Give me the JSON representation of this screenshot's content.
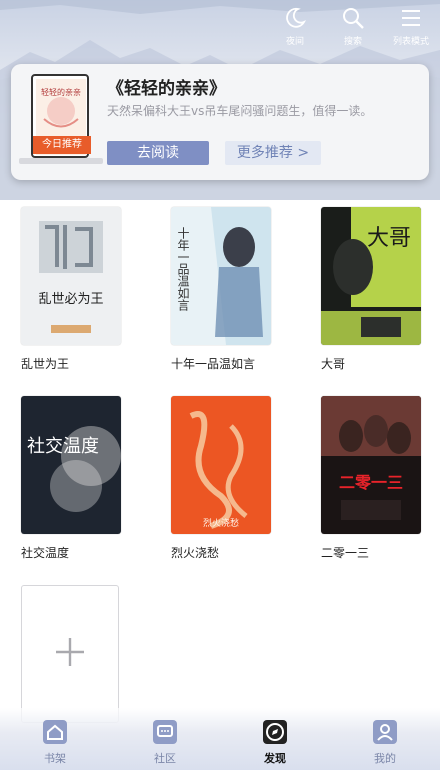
{
  "top_actions": [
    {
      "label": "夜间",
      "icon": "moon-icon"
    },
    {
      "label": "搜索",
      "icon": "search-icon"
    },
    {
      "label": "列表模式",
      "icon": "list-mode-icon"
    }
  ],
  "recommendation": {
    "title": "《轻轻的亲亲》",
    "description": "天然呆偏科大王vs吊车尾闷骚问题生，值得一读。",
    "badge": "今日推荐",
    "read_button": "去阅读",
    "more_button": "更多推荐 >",
    "cover_text": "轻轻的亲亲"
  },
  "books": [
    {
      "name": "乱世为王",
      "cover_text": "乱世必为王"
    },
    {
      "name": "十年一品温如言",
      "cover_text": "十年一品温如言"
    },
    {
      "name": "大哥",
      "cover_text": "大哥"
    },
    {
      "name": "社交温度",
      "cover_text": "社交温度"
    },
    {
      "name": "烈火浇愁",
      "cover_text": "烈火浇愁"
    },
    {
      "name": "二零一三",
      "cover_text": "二零一三"
    }
  ],
  "add_tile": {
    "icon": "plus-icon"
  },
  "tabs": [
    {
      "label": "书架",
      "icon": "bookshelf-icon"
    },
    {
      "label": "社区",
      "icon": "community-icon"
    },
    {
      "label": "发现",
      "icon": "discover-icon",
      "active": true
    },
    {
      "label": "我的",
      "icon": "profile-icon"
    }
  ],
  "colors": {
    "accent": "#7f8fc4",
    "badge": "#e85c2a",
    "tab_inactive": "#7b86a8"
  }
}
